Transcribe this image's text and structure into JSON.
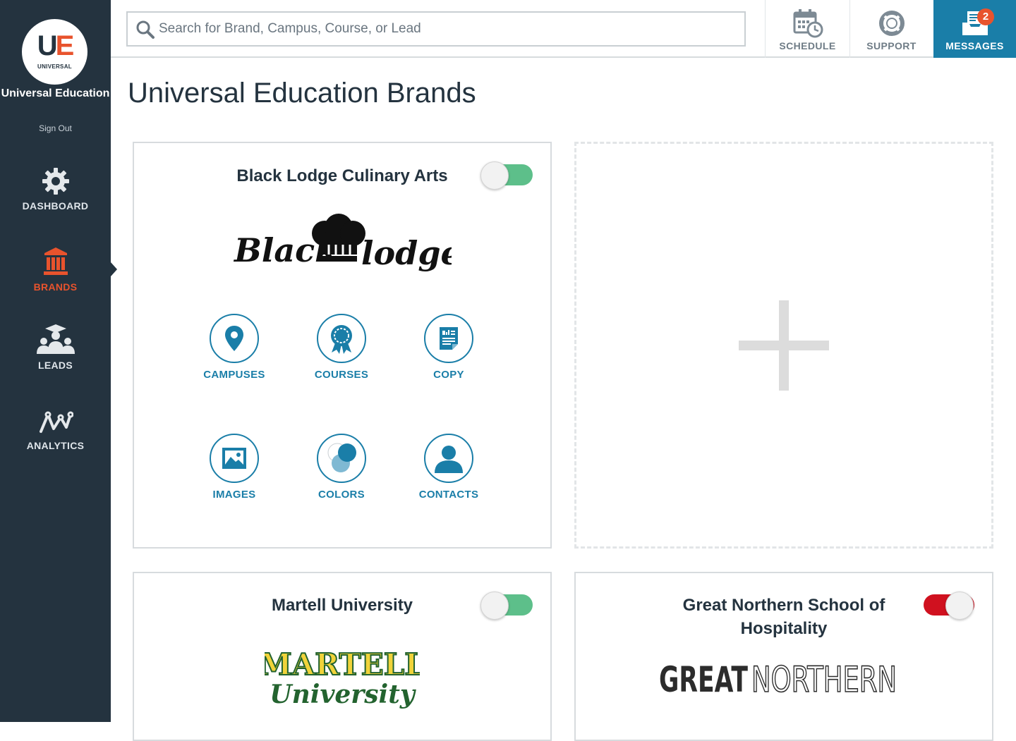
{
  "sidebar": {
    "logo_mark_u": "U",
    "logo_mark_e": "E",
    "logo_sub": "UNIVERSAL",
    "org_name": "Universal Education",
    "sign_out": "Sign Out",
    "items": [
      {
        "label": "DASHBOARD",
        "icon": "gear-icon",
        "active": false
      },
      {
        "label": "BRANDS",
        "icon": "institution-icon",
        "active": true
      },
      {
        "label": "LEADS",
        "icon": "graduates-icon",
        "active": false
      },
      {
        "label": "ANALYTICS",
        "icon": "analytics-icon",
        "active": false
      }
    ]
  },
  "topbar": {
    "search_placeholder": "Search for Brand, Campus, Course, or Lead",
    "search_value": "",
    "schedule_label": "SCHEDULE",
    "support_label": "SUPPORT",
    "messages_label": "MESSAGES",
    "messages_count": "2"
  },
  "page": {
    "title": "Universal Education Brands"
  },
  "brands": [
    {
      "name": "Black Lodge Culinary Arts",
      "enabled": true,
      "logo_left": "Black",
      "logo_right": "lodge",
      "actions": {
        "campuses": "CAMPUSES",
        "courses": "COURSES",
        "copy": "COPY",
        "images": "IMAGES",
        "colors": "COLORS",
        "contacts": "CONTACTS"
      }
    },
    {
      "name": "Martell University",
      "enabled": true,
      "logo_top": "MARTELL",
      "logo_bottom": "University"
    },
    {
      "name": "Great Northern School of Hospitality",
      "enabled": false,
      "logo_left": "GREAT",
      "logo_right": "NORTHERN"
    }
  ],
  "colors": {
    "sidebar_bg": "#24333f",
    "accent_orange": "#e8532d",
    "accent_blue": "#1a7ea8",
    "toggle_on": "#5dbf8a",
    "toggle_off": "#d0111f"
  }
}
